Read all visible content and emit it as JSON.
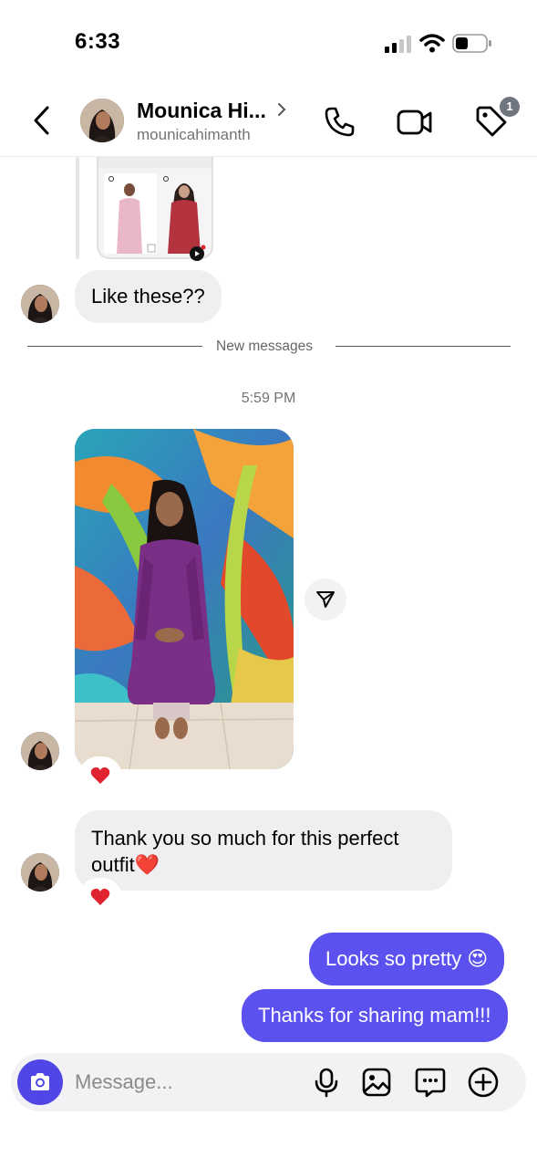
{
  "status_bar": {
    "time": "6:33"
  },
  "header": {
    "contact_name": "Mounica Hi...",
    "contact_username": "mounicahimanth",
    "notification_badge": "1",
    "icons": [
      "back-chevron-icon",
      "phone-icon",
      "video-camera-icon",
      "tag-icon"
    ]
  },
  "messages": {
    "incoming_1": "Like these??",
    "new_messages_label": "New messages",
    "timestamp": "5:59 PM",
    "photo_reaction": "❤️",
    "incoming_2": "Thank you so much for this perfect outfit❤️",
    "incoming_2_reaction": "❤️",
    "outgoing_1": "Looks so pretty 😍",
    "outgoing_2": "Thanks for sharing mam!!!"
  },
  "composer": {
    "placeholder": "Message...",
    "icons": [
      "camera-icon",
      "microphone-icon",
      "gallery-icon",
      "sticker-icon",
      "plus-icon"
    ]
  },
  "colors": {
    "accent": "#5b51ef",
    "incoming_bubble": "#efeff1",
    "heart": "#e0242f"
  }
}
